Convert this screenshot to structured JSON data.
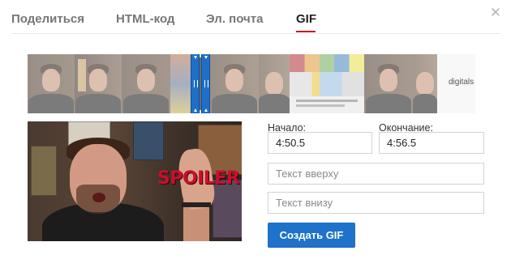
{
  "tabs": [
    {
      "label": "Поделиться",
      "active": false
    },
    {
      "label": "HTML-код",
      "active": false
    },
    {
      "label": "Эл. почта",
      "active": false
    },
    {
      "label": "GIF",
      "active": true
    }
  ],
  "close_icon": "close-icon",
  "filmstrip": {
    "caption": "digitals"
  },
  "preview": {
    "overlay_text": "SPOILER"
  },
  "form": {
    "start_label": "Начало:",
    "start_value": "4:50.5",
    "end_label": "Окончание:",
    "end_value": "4:56.5",
    "top_text_placeholder": "Текст вверху",
    "bottom_text_placeholder": "Текст внизу",
    "create_button_label": "Создать GIF"
  },
  "colors": {
    "accent_tab": "#cc181e",
    "primary_button": "#1f72c9",
    "handle": "#1f6fc7"
  }
}
